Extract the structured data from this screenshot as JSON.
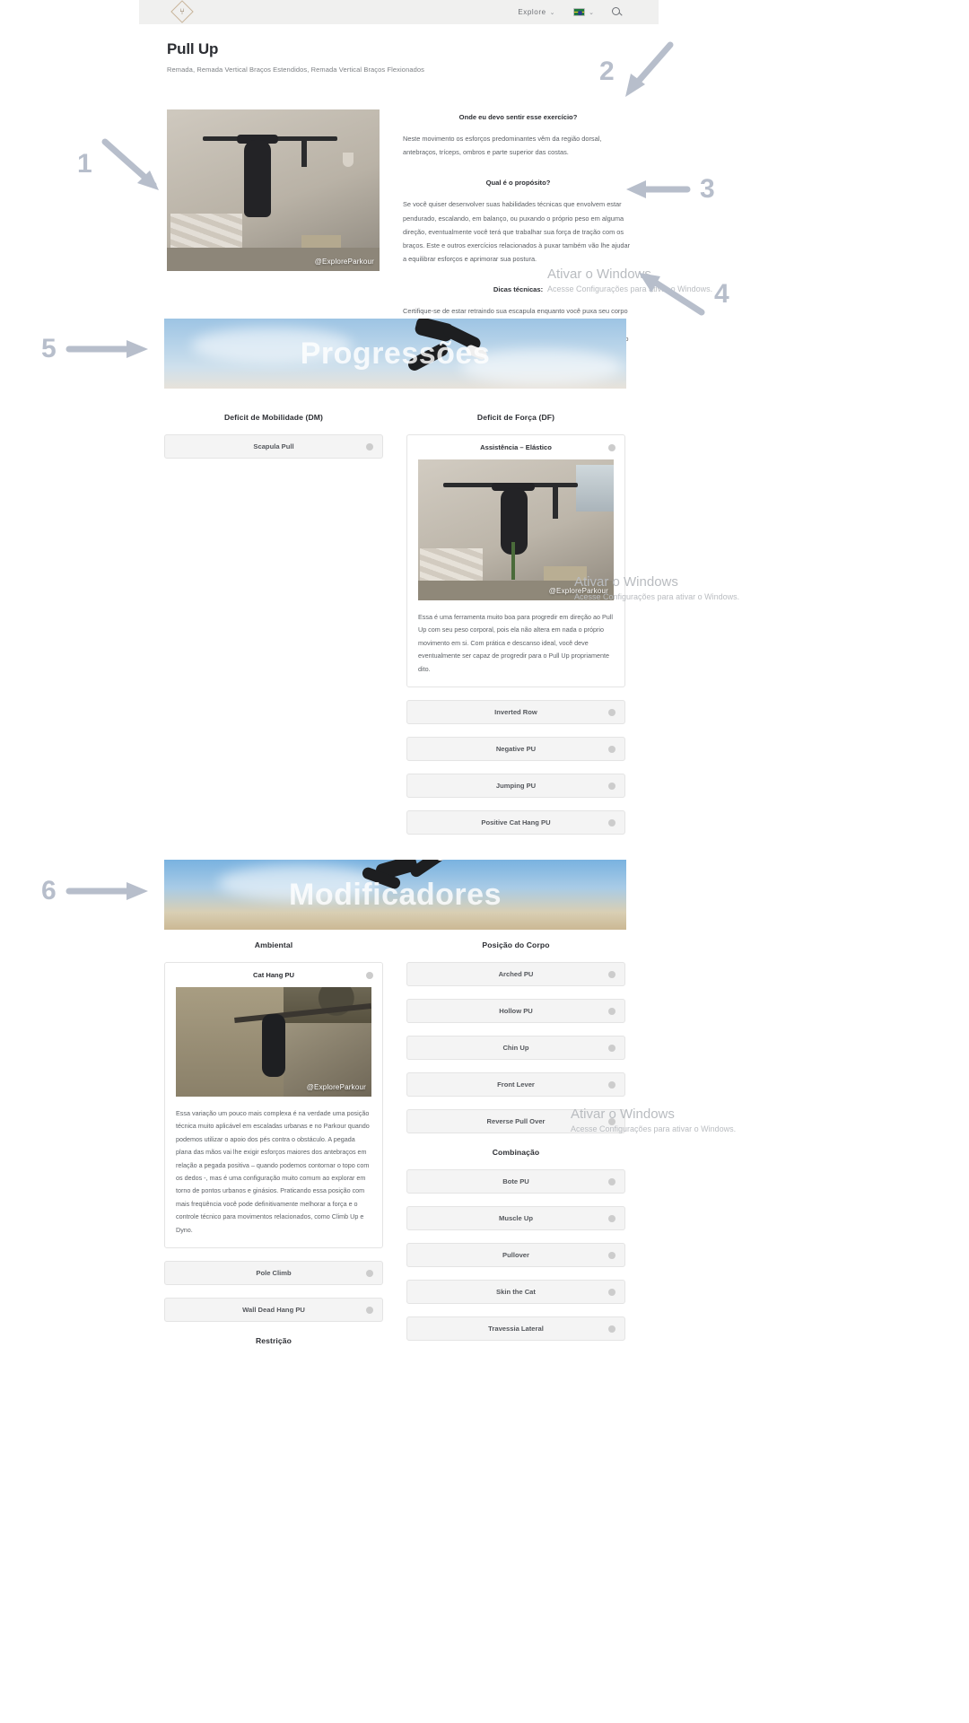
{
  "nav": {
    "brand_mark": "brand-diamond-logo",
    "explore_label": "Explore",
    "caret": "⌄",
    "language_flag": "brazil-flag-icon",
    "search_icon": "search-icon"
  },
  "header": {
    "title": "Pull Up",
    "subtitle": "Remada, Remada Vertical Braços Estendidos, Remada Vertical Braços Flexionados"
  },
  "intro": {
    "photo_watermark": "@ExploreParkour",
    "blocks": [
      {
        "heading": "Onde eu devo sentir esse exercício?",
        "body": "Neste movimento os esforços predominantes vêm da região dorsal, antebraços, tríceps, ombros e parte superior das costas."
      },
      {
        "heading": "Qual é o propósito?",
        "body": "Se você quiser desenvolver suas habilidades técnicas que envolvem estar pendurado, escalando, em balanço, ou puxando o próprio peso em alguma direção, eventualmente você terá que trabalhar sua força de tração com os braços. Este e outros exercícios relacionados à puxar também vão lhe ajudar a equilibrar esforços e aprimorar sua postura."
      },
      {
        "heading": "Dicas técnicas:",
        "body": "Certifique-se de estar retraindo sua escapula enquanto você puxa seu corpo para cima e atente-se a executar o movimento com amplitude completa. Mantendo também o abdomen engajado, bom ritmo e controle da respiração podem lhe ajudar a ser mais eficiente nas suas repetições."
      }
    ]
  },
  "banners": {
    "progressions": "Progressões",
    "modifiers": "Modificadores"
  },
  "progressions": {
    "left_column": {
      "title": "Deficit de Mobilidade (DM)",
      "items": [
        {
          "label": "Scapula Pull"
        }
      ]
    },
    "right_column": {
      "title": "Deficit de Força (DF)",
      "card": {
        "title": "Assistência – Elástico",
        "watermark": "@ExploreParkour",
        "body": "Essa é uma ferramenta muito boa para progredir em direção ao Pull Up com seu peso corporal, pois ela não altera em nada o próprio movimento em si. Com prática e descanso ideal, você deve eventualmente ser capaz de progredir para o Pull Up propriamente dito."
      },
      "items": [
        {
          "label": "Inverted Row"
        },
        {
          "label": "Negative PU"
        },
        {
          "label": "Jumping PU"
        },
        {
          "label": "Positive Cat Hang PU"
        }
      ]
    }
  },
  "modifiers": {
    "left_column": {
      "title": "Ambiental",
      "card": {
        "title": "Cat Hang PU",
        "watermark": "@ExploreParkour",
        "body": "Essa variação um pouco mais complexa é na verdade uma posição técnica muito aplicável em escaladas urbanas e no Parkour quando podemos utilizar o apoio dos pés contra o obstáculo. A pegada plana das mãos vai lhe exigir esforços maiores dos antebraços em relação a pegada positiva – quando podemos contornar o topo com os dedos -, mas é uma configuração muito comum ao explorar em torno de pontos urbanos e ginásios. Praticando essa posição com mais freqüência você pode definitivamente melhorar a força e o controle técnico para movimentos relacionados, como Climb Up e Dyno."
      },
      "items": [
        {
          "label": "Pole Climb"
        },
        {
          "label": "Wall Dead Hang PU"
        }
      ],
      "sub_title": "Restrição"
    },
    "right_column": {
      "title": "Posição do Corpo",
      "items": [
        {
          "label": "Arched PU"
        },
        {
          "label": "Hollow PU"
        },
        {
          "label": "Chin Up"
        },
        {
          "label": "Front Lever"
        },
        {
          "label": "Reverse Pull Over"
        }
      ],
      "sub_title": "Combinação",
      "sub_items": [
        {
          "label": "Bote PU"
        },
        {
          "label": "Muscle Up"
        },
        {
          "label": "Pullover"
        },
        {
          "label": "Skin the Cat"
        },
        {
          "label": "Travessia Lateral"
        }
      ]
    }
  },
  "annotations": [
    {
      "number": "1"
    },
    {
      "number": "2"
    },
    {
      "number": "3"
    },
    {
      "number": "4"
    },
    {
      "number": "5"
    },
    {
      "number": "6"
    }
  ],
  "windows_watermarks": [
    {
      "line1": "Ativar o Windows",
      "line2": "Acesse Configurações para ativar o Windows."
    },
    {
      "line1": "Ativar o Windows",
      "line2": "Acesse Configurações para ativar o Windows."
    },
    {
      "line1": "Ativar o Windows",
      "line2": "Acesse Configurações para ativar o Windows."
    }
  ],
  "colors": {
    "annotation": "#b7becb",
    "pill_bg": "#f4f4f4",
    "nav_bg": "#f0f0ef"
  }
}
